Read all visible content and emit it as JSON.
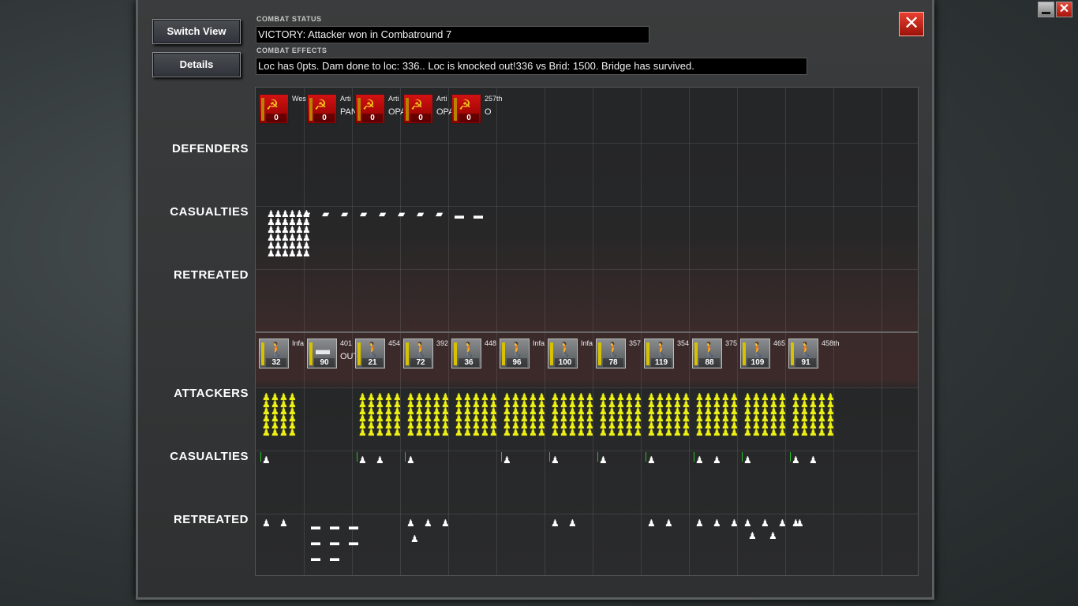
{
  "window_controls": {
    "minimize_label": "",
    "close_label": "✕"
  },
  "buttons": {
    "switch_view": "Switch View",
    "details": "Details",
    "close": "✕"
  },
  "combat_status": {
    "header": "COMBAT STATUS",
    "text": "VICTORY: Attacker won in Combatround  7"
  },
  "combat_effects": {
    "header": "COMBAT EFFECTS",
    "text": "Loc has  0pts. Dam done to loc: 336.. Loc is knocked out!336 vs Brid: 1500. Bridge has survived."
  },
  "row_labels": {
    "defenders": "DEFENDERS",
    "def_casualties": "CASUALTIES",
    "def_retreated": "RETREATED",
    "attackers": "ATTACKERS",
    "att_casualties": "CASUALTIES",
    "att_retreated": "RETREATED"
  },
  "defenders": [
    {
      "value": "0",
      "name": "Wes",
      "icon": "hammer-sickle-icon"
    },
    {
      "value": "0",
      "name": "Arti",
      "name2": "PAN",
      "icon": "hammer-sickle-icon"
    },
    {
      "value": "0",
      "name": "Arti",
      "name2": "OPAN",
      "icon": "hammer-sickle-icon"
    },
    {
      "value": "0",
      "name": "Arti",
      "name2": "OPAN",
      "icon": "hammer-sickle-icon"
    },
    {
      "value": "0",
      "name": "257th",
      "name2": "O",
      "icon": "hammer-sickle-icon"
    }
  ],
  "attackers": [
    {
      "value": "32",
      "name": "Infa",
      "icon": "infantry-icon"
    },
    {
      "value": "90",
      "name": "401",
      "name2": "OUT",
      "icon": "tank-icon"
    },
    {
      "value": "21",
      "name": "454",
      "icon": "infantry-icon"
    },
    {
      "value": "72",
      "name": "392",
      "icon": "infantry-icon"
    },
    {
      "value": "36",
      "name": "448",
      "icon": "infantry-icon"
    },
    {
      "value": "96",
      "name": "Infa",
      "icon": "infantry-icon"
    },
    {
      "value": "100",
      "name": "Infa",
      "icon": "infantry-icon"
    },
    {
      "value": "78",
      "name": "357",
      "icon": "infantry-icon"
    },
    {
      "value": "119",
      "name": "354",
      "icon": "infantry-icon"
    },
    {
      "value": "88",
      "name": "375",
      "icon": "infantry-icon"
    },
    {
      "value": "109",
      "name": "465",
      "icon": "infantry-icon"
    },
    {
      "value": "91",
      "name": "458th",
      "icon": "infantry-icon"
    }
  ],
  "colors": {
    "soviet": "#c80000",
    "german": "#6f7274",
    "casualty_highlight": "#ecf016",
    "strength_tick": "#27c227"
  }
}
